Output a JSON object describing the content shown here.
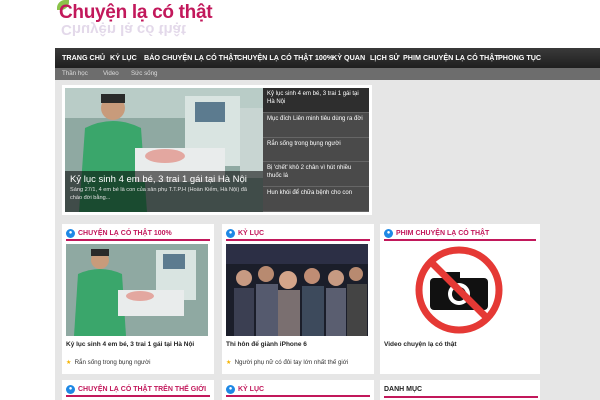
{
  "logo": {
    "text": "Chuyện lạ có thật"
  },
  "nav": {
    "items": [
      "TRANG CHỦ",
      "KỶ LỤC",
      "BÁO CHUYỆN LẠ CÓ THẬT",
      "CHUYỆN LẠ CÓ THẬT 100%",
      "KỲ QUAN",
      "LỊCH SỬ",
      "PHIM CHUYỆN LẠ CÓ THẬT",
      "PHONG TỤC"
    ],
    "sub_items": [
      "Thần học",
      "Video",
      "Sức sống"
    ]
  },
  "slider": {
    "title": "Kỷ lục sinh 4 em bé, 3 trai 1 gái tại Hà Nội",
    "excerpt": "Sáng 27/1, 4 em bé là con của sản phụ T.T.P.H (Hoàn Kiếm, Hà Nội) đã chào đời bằng...",
    "list": [
      "Kỷ lục sinh 4 em bé, 3 trai 1 gái tại Hà Nội",
      "Mục đích Liên minh tiêu dùng ra đời",
      "Rắn sống trong bụng người",
      "Bị 'chết' khô 2 chân vì hút nhiều thuốc lá",
      "Hun khói để chữa bệnh cho con"
    ]
  },
  "sections": [
    {
      "title": "CHUYỆN LẠ CÓ THẬT 100%",
      "caption": "Kỷ lục sinh 4 em bé, 3 trai 1 gái tại Hà Nội",
      "sub": "Rắn sống trong bụng người"
    },
    {
      "title": "KỶ LỤC",
      "caption": "Thi hôn để giành iPhone 6",
      "sub": "Người phụ nữ có đôi tay lớn nhất thế giới"
    },
    {
      "title": "PHIM CHUYỆN LẠ CÓ THẬT",
      "caption": "Video chuyện lạ có thật",
      "sub": ""
    }
  ],
  "bottom_sections": [
    {
      "title": "CHUYỆN LẠ CÓ THẬT TRÊN THẾ GIỚI"
    },
    {
      "title": "KỶ LỤC"
    }
  ],
  "sidebar": {
    "danh_muc": "DANH MỤC"
  },
  "colors": {
    "accent": "#c2185b",
    "nav_bg": "#2b2b2b",
    "icon_blue": "#1e88e5"
  }
}
